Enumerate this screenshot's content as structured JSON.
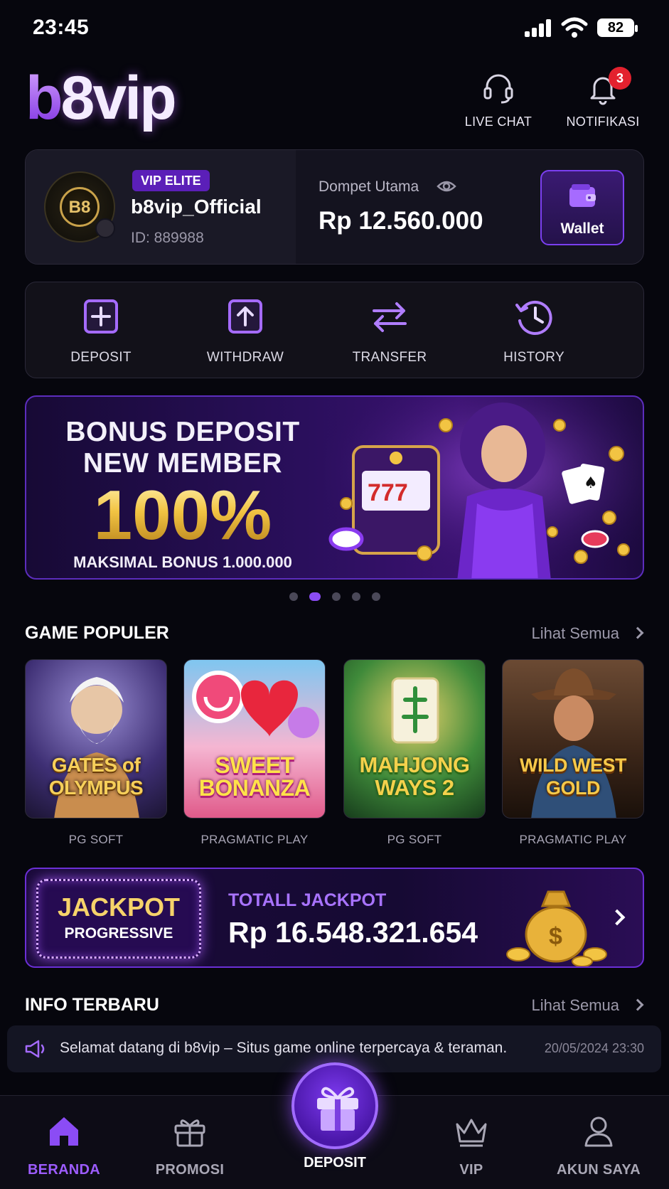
{
  "status_bar": {
    "time": "23:45",
    "battery": "82"
  },
  "header": {
    "logo_b": "b",
    "logo_rest": "8vip",
    "live_chat_label": "LIVE CHAT",
    "notification_label": "NOTIFIKASI",
    "notification_count": "3"
  },
  "account": {
    "avatar_text": "B8",
    "vip_level": "VIP ELITE",
    "username": "b8vip_Official",
    "user_id": "ID: 889988",
    "wallet_label": "Dompet Utama",
    "balance": "Rp 12.560.000",
    "wallet_button": "Wallet"
  },
  "quick_actions": [
    {
      "label": "DEPOSIT",
      "icon": "plus-square-icon"
    },
    {
      "label": "WITHDRAW",
      "icon": "arrow-up-square-icon"
    },
    {
      "label": "TRANSFER",
      "icon": "swap-arrows-icon"
    },
    {
      "label": "HISTORY",
      "icon": "history-clock-icon"
    }
  ],
  "banner": {
    "line1": "BONUS DEPOSIT",
    "line2": "NEW MEMBER",
    "percent": "100%",
    "subline": "MAKSIMAL BONUS 1.000.000",
    "slide_count": 5,
    "active_slide": 1
  },
  "games_section": {
    "title": "GAME POPULER",
    "see_all": "Lihat Semua",
    "games": [
      {
        "name": "GATES of OLYMPUS",
        "provider": "PG SOFT"
      },
      {
        "name": "SWEET BONANZA",
        "provider": "PRAGMATIC PLAY"
      },
      {
        "name": "MAHJONG WAYS 2",
        "provider": "PG SOFT"
      },
      {
        "name": "WILD WEST GOLD",
        "provider": "PRAGMATIC PLAY"
      }
    ]
  },
  "jackpot": {
    "badge_line1": "JACKPOT",
    "badge_line2": "PROGRESSIVE",
    "label": "TOTALL JACKPOT",
    "value": "Rp 16.548.321.654"
  },
  "info_section": {
    "title": "INFO TERBARU",
    "see_all": "Lihat Semua",
    "news_text": "Selamat datang di b8vip – Situs game online terpercaya & teraman.",
    "news_date": "20/05/2024 23:30"
  },
  "bottom_nav": {
    "items": [
      {
        "label": "BERANDA",
        "icon": "home-icon",
        "active": true
      },
      {
        "label": "PROMOSI",
        "icon": "gift-outline-icon",
        "active": false
      },
      {
        "label": "DEPOSIT",
        "icon": "gift-icon",
        "active": false
      },
      {
        "label": "VIP",
        "icon": "crown-icon",
        "active": false
      },
      {
        "label": "AKUN SAYA",
        "icon": "user-icon",
        "active": false
      }
    ]
  },
  "colors": {
    "accent": "#8b4cf5",
    "gold": "#f2c443",
    "background": "#06060d"
  }
}
